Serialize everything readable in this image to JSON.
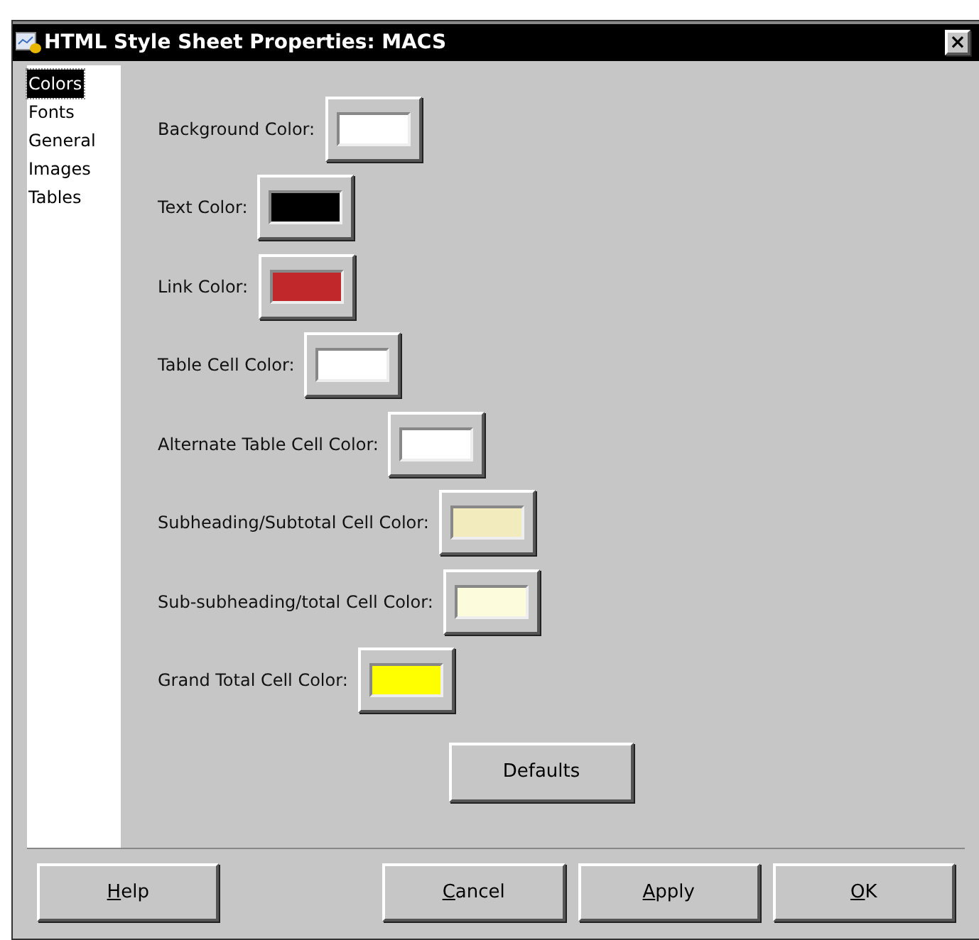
{
  "window": {
    "title": "HTML Style Sheet Properties: MACS",
    "close": "×"
  },
  "sidebar": {
    "items": [
      {
        "label": "Colors",
        "selected": true
      },
      {
        "label": "Fonts",
        "selected": false
      },
      {
        "label": "General",
        "selected": false
      },
      {
        "label": "Images",
        "selected": false
      },
      {
        "label": "Tables",
        "selected": false
      }
    ]
  },
  "colors": [
    {
      "label": "Background Color:",
      "color": "#ffffff"
    },
    {
      "label": "Text Color:",
      "color": "#000000"
    },
    {
      "label": "Link Color:",
      "color": "#c0282c"
    },
    {
      "label": "Table Cell Color:",
      "color": "#ffffff"
    },
    {
      "label": "Alternate Table Cell Color:",
      "color": "#ffffff"
    },
    {
      "label": "Subheading/Subtotal Cell Color:",
      "color": "#f1ebbe"
    },
    {
      "label": "Sub-subheading/total Cell Color:",
      "color": "#fcfbdc"
    },
    {
      "label": "Grand Total Cell Color:",
      "color": "#ffff00"
    }
  ],
  "defaults_button": "Defaults",
  "buttons": [
    {
      "label": "Help",
      "underline_first": true
    },
    {
      "label": "Cancel",
      "underline_first": true
    },
    {
      "label": "Apply",
      "underline_first": true
    },
    {
      "label": "OK",
      "underline_first": true
    }
  ]
}
